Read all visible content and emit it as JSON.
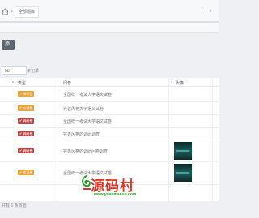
{
  "breadcrumb": {
    "separator": ">",
    "tab_label": "全部题库",
    "prev": "‹",
    "next": "›"
  },
  "toolbar": {
    "action_label": "添"
  },
  "pager": {
    "page_size": "50",
    "per_page_label": "条记录"
  },
  "table": {
    "headers": {
      "type": "类型",
      "question": "问卷",
      "image": "头像",
      "extra": ""
    },
    "rows": [
      {
        "badge": "考试卷",
        "badge_kind": "exam",
        "text": "全国统一考试大学语文试卷",
        "has_image": false,
        "dot": ""
      },
      {
        "badge": "考试卷",
        "badge_kind": "exam",
        "text": "完善风格大学语文试卷",
        "has_image": false,
        "dot": ""
      },
      {
        "badge": "调研卷",
        "badge_kind": "survey",
        "text": "全国统一考试大学语文试卷",
        "has_image": false,
        "dot": ""
      },
      {
        "badge": "调研卷",
        "badge_kind": "survey",
        "text": "完善风格的调研调查",
        "has_image": false,
        "dot": ""
      },
      {
        "badge": "调研卷",
        "badge_kind": "survey",
        "text": "完善风格的调研问卷调查",
        "has_image": true,
        "dot": ""
      },
      {
        "badge": "考试卷",
        "badge_kind": "exam",
        "text": "全国统一考试大学语文试卷",
        "has_image": true,
        "dot": ""
      }
    ]
  },
  "watermark": {
    "title": "源码村",
    "url": "www.yuanmacun.com"
  },
  "footer": {
    "summary": "共有 6 条数据"
  },
  "colors": {
    "exam_badge": "#e8a33c",
    "survey_badge": "#b54a4a",
    "action_button": "#5f6770"
  },
  "icons": {
    "home": "home-icon",
    "badge_check": "check-icon"
  }
}
